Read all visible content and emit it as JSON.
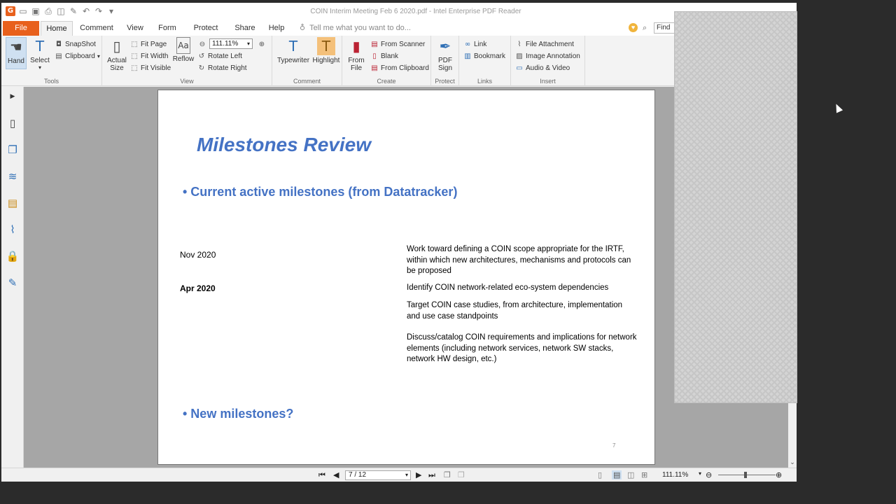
{
  "window": {
    "title": "COIN Interim Meeting Feb 6 2020.pdf - Intel Enterprise PDF Reader"
  },
  "tabs": [
    "File",
    "Home",
    "Comment",
    "View",
    "Form",
    "Protect",
    "Share",
    "Help"
  ],
  "tellme": "Tell me what you want to do...",
  "find": "Find",
  "ribbon": {
    "tools": {
      "label": "Tools",
      "hand": "Hand",
      "select": "Select",
      "snapshot": "SnapShot",
      "clipboard": "Clipboard"
    },
    "view": {
      "label": "View",
      "actual_size_1": "Actual",
      "actual_size_2": "Size",
      "fit_page": "Fit Page",
      "fit_width": "Fit Width",
      "fit_visible": "Fit Visible",
      "reflow": "Reflow",
      "zoom": "111.11%",
      "rotate_left": "Rotate Left",
      "rotate_right": "Rotate Right"
    },
    "comment": {
      "label": "Comment",
      "typewriter": "Typewriter",
      "highlight": "Highlight"
    },
    "create": {
      "label": "Create",
      "from_file_1": "From",
      "from_file_2": "File",
      "from_scanner": "From Scanner",
      "blank": "Blank",
      "from_clipboard": "From Clipboard"
    },
    "protect": {
      "label": "Protect",
      "pdf_sign_1": "PDF",
      "pdf_sign_2": "Sign"
    },
    "links": {
      "label": "Links",
      "link": "Link",
      "bookmark": "Bookmark"
    },
    "insert": {
      "label": "Insert",
      "file_attachment": "File Attachment",
      "image_annotation": "Image Annotation",
      "audio_video": "Audio & Video"
    }
  },
  "slide": {
    "title": "Milestones Review",
    "bullet1": "• Current active milestones (from Datatracker)",
    "milestones": [
      {
        "date": "Nov 2020",
        "desc": "Work toward defining a COIN scope appropriate for the IRTF, within which new architectures, mechanisms and protocols can be proposed"
      },
      {
        "date": "Apr 2020",
        "desc": "Identify COIN network-related eco-system dependencies"
      },
      {
        "date": "",
        "desc": "Target COIN case studies, from architecture, implementation and use case standpoints"
      },
      {
        "date": "",
        "desc": "Discuss/catalog COIN requirements and implications for network elements (including network services, network SW stacks, network HW design, etc.)"
      }
    ],
    "bullet2": "• New milestones?",
    "page_number": "7"
  },
  "statusbar": {
    "page": "7 / 12",
    "zoom": "111.11%"
  }
}
